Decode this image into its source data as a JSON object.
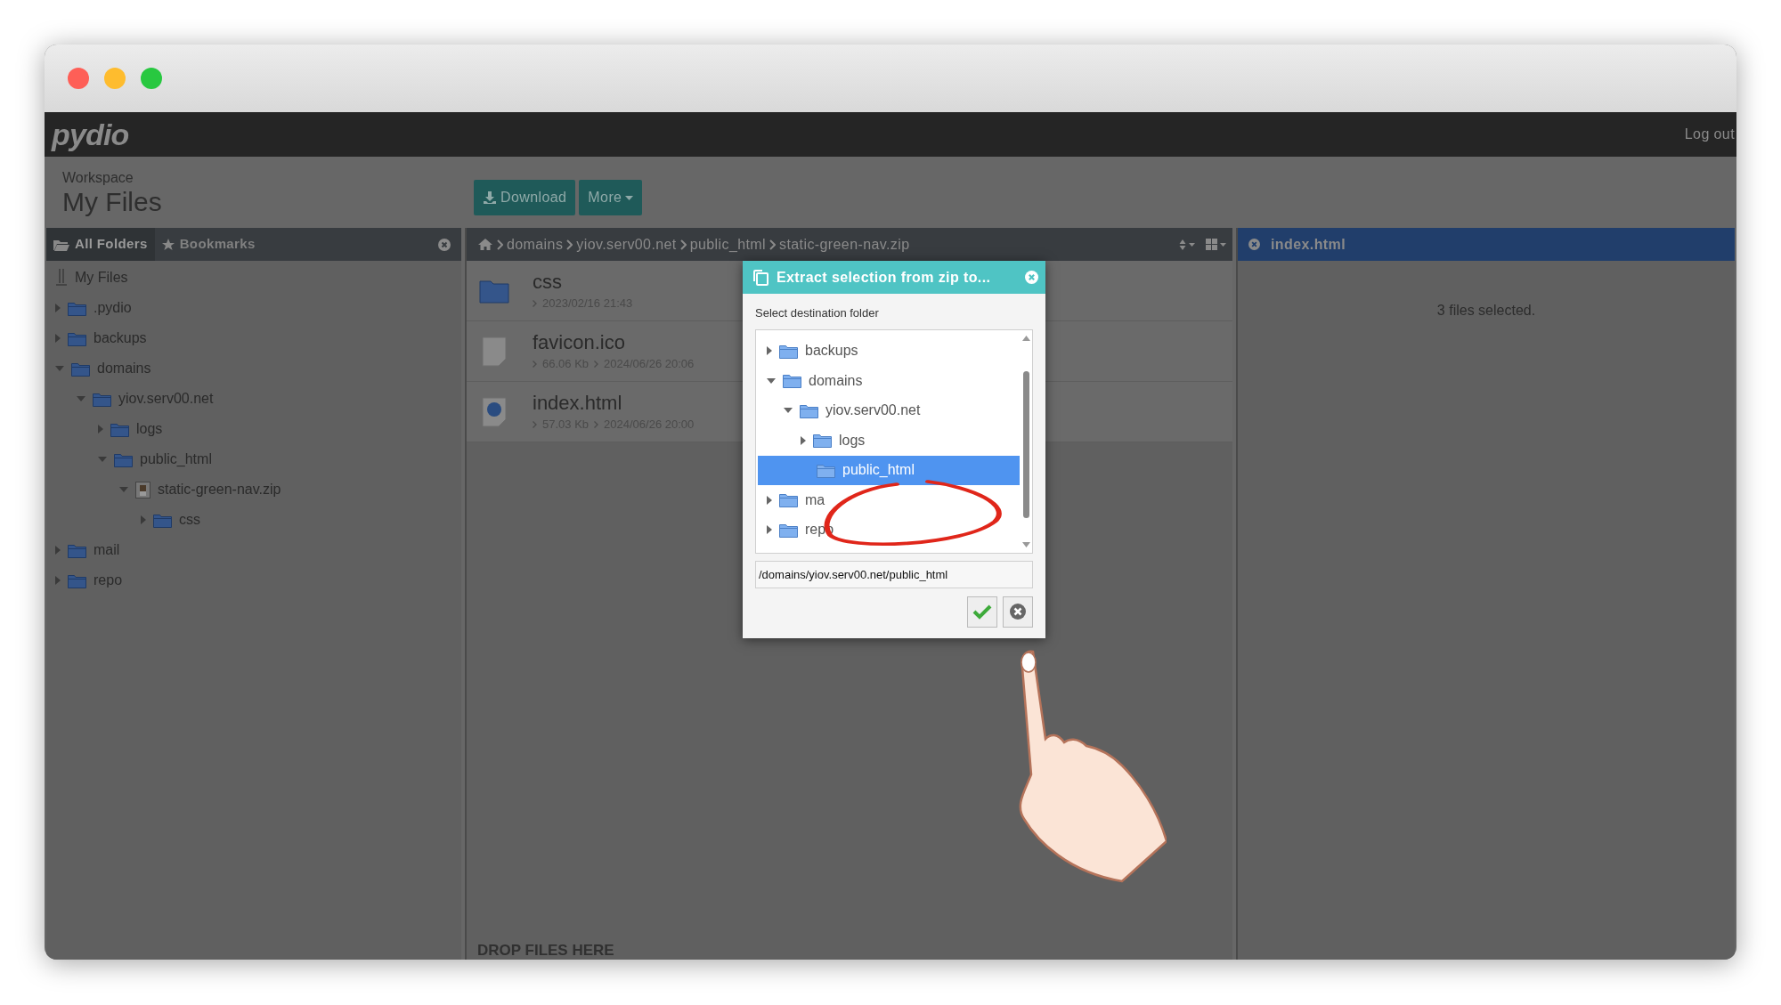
{
  "app_header": {
    "logo": "pydio",
    "logout": "Log out"
  },
  "workspace": {
    "label": "Workspace",
    "title": "My Files"
  },
  "toolbar": [
    {
      "label": "Download"
    },
    {
      "label": "More"
    }
  ],
  "left_panel": {
    "tabs": [
      {
        "label": "All Folders",
        "selected": true
      },
      {
        "label": "Bookmarks",
        "selected": false
      }
    ],
    "tree": [
      {
        "label": "My Files",
        "kind": "workspace",
        "children": [
          {
            "label": ".pydio",
            "kind": "folder",
            "expanded": false
          },
          {
            "label": "backups",
            "kind": "folder",
            "expanded": false
          },
          {
            "label": "domains",
            "kind": "folder",
            "expanded": true,
            "children": [
              {
                "label": "yiov.serv00.net",
                "kind": "folder",
                "expanded": true,
                "children": [
                  {
                    "label": "logs",
                    "kind": "folder",
                    "expanded": false
                  },
                  {
                    "label": "public_html",
                    "kind": "folder",
                    "expanded": true,
                    "children": [
                      {
                        "label": "static-green-nav.zip",
                        "kind": "archive",
                        "expanded": true,
                        "children": [
                          {
                            "label": "css",
                            "kind": "folder",
                            "expanded": false
                          }
                        ]
                      }
                    ]
                  }
                ]
              }
            ]
          },
          {
            "label": "mail",
            "kind": "folder",
            "expanded": false
          },
          {
            "label": "repo",
            "kind": "folder",
            "expanded": false
          }
        ]
      }
    ]
  },
  "breadcrumb": [
    "domains",
    "yiov.serv00.net",
    "public_html",
    "static-green-nav.zip"
  ],
  "files": [
    {
      "name": "css",
      "kind": "folder",
      "meta": [
        "2023/02/16 21:43"
      ]
    },
    {
      "name": "favicon.ico",
      "kind": "file",
      "meta": [
        "66.06 Kb",
        "2024/06/26 20:06"
      ]
    },
    {
      "name": "index.html",
      "kind": "web",
      "meta": [
        "57.03 Kb",
        "2024/06/26 20:00"
      ]
    }
  ],
  "drop_hint": "DROP FILES HERE",
  "right_panel": {
    "title": "index.html",
    "message": "3 files selected."
  },
  "dialog": {
    "title": "Extract selection from zip to...",
    "prompt": "Select destination folder",
    "tree": [
      {
        "label": "backups",
        "expanded": false,
        "selected": false
      },
      {
        "label": "domains",
        "expanded": true,
        "selected": false,
        "children": [
          {
            "label": "yiov.serv00.net",
            "expanded": true,
            "selected": false,
            "children": [
              {
                "label": "logs",
                "expanded": false,
                "selected": false
              },
              {
                "label": "public_html",
                "selected": true
              }
            ]
          }
        ]
      },
      {
        "label": "ma",
        "expanded": false,
        "selected": false
      },
      {
        "label": "repo",
        "expanded": false,
        "selected": false
      }
    ],
    "path": "/domains/yiov.serv00.net/public_html"
  }
}
